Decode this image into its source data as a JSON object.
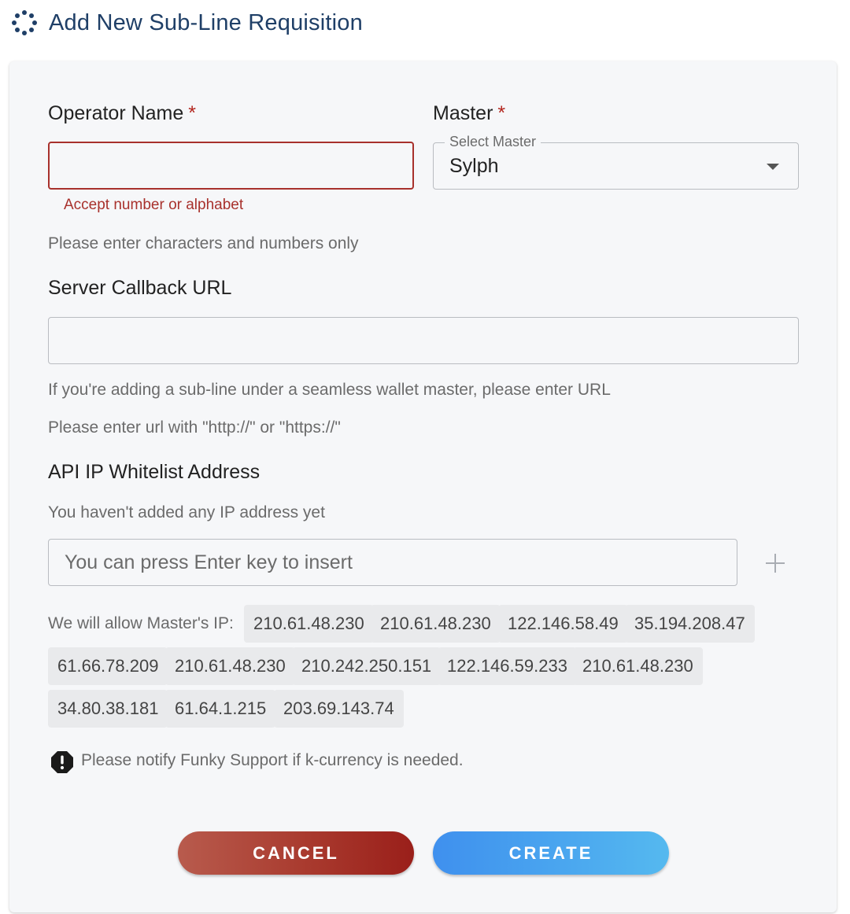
{
  "header": {
    "title": "Add New Sub-Line Requisition",
    "logo_icon": "spinner-dots-icon",
    "accent_color": "#1f3f67"
  },
  "form": {
    "operator_name": {
      "label": "Operator Name",
      "required_mark": "*",
      "value": "",
      "error": "Accept number or alphabet",
      "help": "Please enter characters and numbers only"
    },
    "master": {
      "label": "Master",
      "required_mark": "*",
      "select_legend": "Select Master",
      "selected_value": "Sylph"
    },
    "server_callback_url": {
      "label": "Server Callback URL",
      "value": "",
      "help_1": "If you're adding a sub-line under a seamless wallet master, please enter URL",
      "help_2": "Please enter url with \"http://\" or \"https://\""
    },
    "api_ip_whitelist": {
      "label": "API IP Whitelist Address",
      "empty_text": "You haven't added any IP address yet",
      "input_placeholder": "You can press Enter key to insert",
      "allow_prefix": "We will allow Master's IP:",
      "master_ips": [
        "210.61.48.230",
        "210.61.48.230",
        "122.146.58.49",
        "35.194.208.47",
        "61.66.78.209",
        "210.61.48.230",
        "210.242.250.151",
        "122.146.59.233",
        "210.61.48.230",
        "34.80.38.181",
        "61.64.1.215",
        "203.69.143.74"
      ]
    },
    "notice": "Please notify Funky Support if k-currency is needed."
  },
  "buttons": {
    "cancel": "CANCEL",
    "create": "CREATE"
  },
  "colors": {
    "error": "#a8312c",
    "cancel_gradient": [
      "#b85b4d",
      "#9a1f1a"
    ],
    "create_gradient": [
      "#3f90ee",
      "#55b9ef"
    ]
  }
}
